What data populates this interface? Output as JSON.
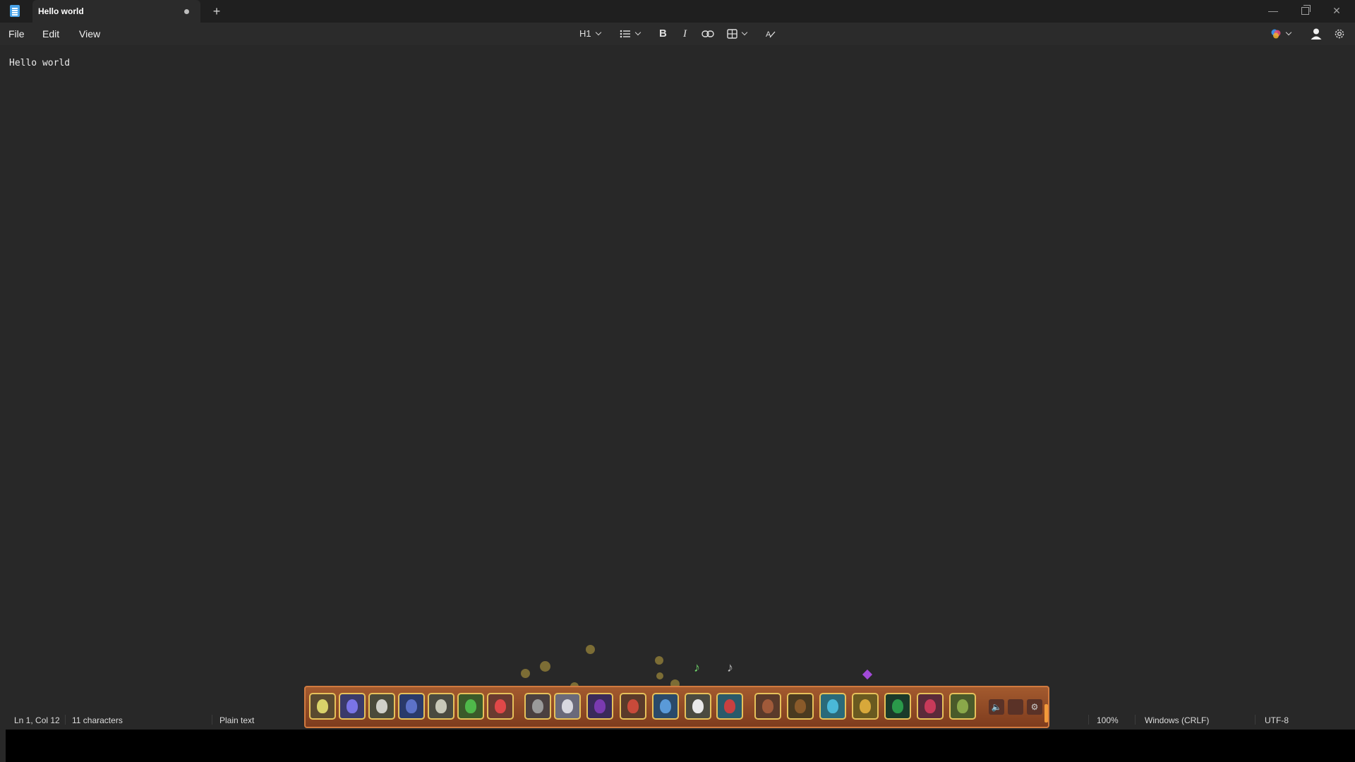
{
  "titlebar": {
    "tab_title": "Hello world",
    "new_tab_glyph": "+",
    "minimize_glyph": "—",
    "close_glyph": "✕"
  },
  "menu": {
    "file": "File",
    "edit": "Edit",
    "view": "View"
  },
  "toolbar": {
    "heading": "H1",
    "bold": "B",
    "italic": "I"
  },
  "editor": {
    "content": "Hello world"
  },
  "status": {
    "position": "Ln 1, Col 12",
    "characters": "11 characters",
    "format": "Plain text",
    "zoom": "100%",
    "line_ending": "Windows (CRLF)",
    "encoding": "UTF-8"
  },
  "hotbar": {
    "slots": [
      {
        "icon": "yellow-egg-icon",
        "color": "#d9d36a"
      },
      {
        "icon": "blue-egg-icon",
        "color": "#7a74e6"
      },
      {
        "icon": "bone-creature-icon",
        "color": "#d0d0c8"
      },
      {
        "icon": "blue-figure-icon",
        "color": "#5c72c8"
      },
      {
        "icon": "pale-creature-icon",
        "color": "#c8c8b8"
      },
      {
        "icon": "green-clover-icon",
        "color": "#4fb84a"
      },
      {
        "icon": "red-egg-icon",
        "color": "#e04848"
      },
      {
        "icon": "grey-shell-icon",
        "color": "#9a9a9a"
      },
      {
        "icon": "ghost-creature-icon",
        "color": "#d8d8e0"
      },
      {
        "icon": "purple-fish-icon",
        "color": "#7a3ab0"
      },
      {
        "icon": "red-bug-icon",
        "color": "#c84a3a"
      },
      {
        "icon": "blue-fish-icon",
        "color": "#5a9ad8"
      },
      {
        "icon": "white-bear-icon",
        "color": "#e8e8e8"
      },
      {
        "icon": "red-book-icon",
        "color": "#c84040"
      },
      {
        "icon": "brown-worm-icon",
        "color": "#a05a3a"
      },
      {
        "icon": "brown-sack-icon",
        "color": "#8a5a2a"
      },
      {
        "icon": "cyan-ghost-icon",
        "color": "#4ab8d8"
      },
      {
        "icon": "gold-orb-icon",
        "color": "#d8a83a"
      },
      {
        "icon": "green-door-icon",
        "color": "#2a9a4a"
      },
      {
        "icon": "red-mask-icon",
        "color": "#c83a5a"
      },
      {
        "icon": "olive-creature-icon",
        "color": "#8aa84a"
      }
    ],
    "sound_glyph": "🔈",
    "settings_glyph": "⚙"
  }
}
